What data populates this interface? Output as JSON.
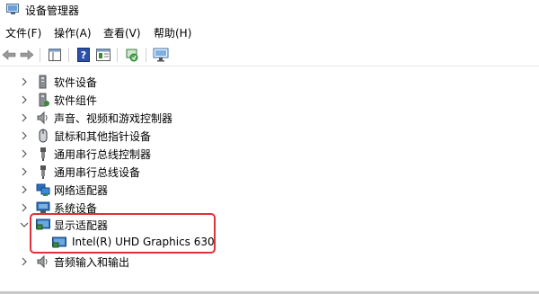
{
  "window": {
    "title": "设备管理器"
  },
  "menu": [
    {
      "label": "文件(F)"
    },
    {
      "label": "操作(A)"
    },
    {
      "label": "查看(V)"
    },
    {
      "label": "帮助(H)"
    }
  ],
  "tree": {
    "items": [
      {
        "label": "软件设备",
        "icon": "software-device-icon",
        "expanded": false
      },
      {
        "label": "软件组件",
        "icon": "software-component-icon",
        "expanded": false
      },
      {
        "label": "声音、视频和游戏控制器",
        "icon": "speaker-icon",
        "expanded": false
      },
      {
        "label": "鼠标和其他指针设备",
        "icon": "mouse-icon",
        "expanded": false
      },
      {
        "label": "通用串行总线控制器",
        "icon": "usb-icon",
        "expanded": false
      },
      {
        "label": "通用串行总线设备",
        "icon": "usb-icon",
        "expanded": false
      },
      {
        "label": "网络适配器",
        "icon": "network-adapter-icon",
        "expanded": false
      },
      {
        "label": "系统设备",
        "icon": "system-device-icon",
        "expanded": false
      },
      {
        "label": "显示适配器",
        "icon": "display-adapter-icon",
        "expanded": true
      },
      {
        "label": "Intel(R) UHD Graphics 630",
        "icon": "display-adapter-icon",
        "child": true
      },
      {
        "label": "音频输入和输出",
        "icon": "audio-io-icon",
        "expanded": false
      }
    ]
  },
  "colors": {
    "highlight": "#e0303a",
    "monitor": "#2a6fbf"
  }
}
